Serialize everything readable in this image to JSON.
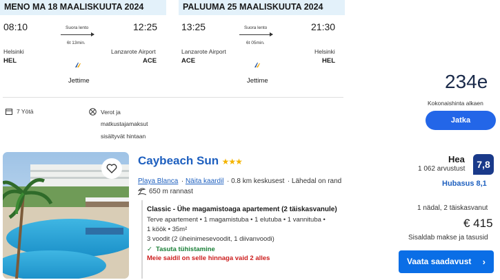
{
  "outbound": {
    "header": "MENO MA 18 MAALISKUUTA 2024",
    "depart_time": "08:10",
    "arrive_time": "12:25",
    "stop_label": "Suora lento",
    "duration": "6t 13min.",
    "depart_city": "Helsinki",
    "depart_code": "HEL",
    "arrive_city": "Lanzarote Airport",
    "arrive_code": "ACE",
    "airline": "Jettime"
  },
  "return": {
    "header": "PALUUMA 25 MAALISKUUTA 2024",
    "depart_time": "13:25",
    "arrive_time": "21:30",
    "stop_label": "Suora lento",
    "duration": "6t 05min.",
    "depart_city": "Lanzarote Airport",
    "depart_code": "ACE",
    "arrive_city": "Helsinki",
    "arrive_code": "HEL",
    "airline": "Jettime"
  },
  "package": {
    "nights": "7 Yötä",
    "taxes_line1": "Verot ja",
    "taxes_line2": "matkustajamaksut",
    "taxes_line3": "sisältyvät hintaan",
    "price": "234e",
    "price_caption": "Kokonaishinta alkaen",
    "continue_label": "Jatka"
  },
  "hotel": {
    "name": "Caybeach Sun",
    "stars": "★★★",
    "area": "Playa Blanca",
    "map_link": "Näita kaardil",
    "center_distance": "0.8 km keskusest",
    "beach_near": "Lähedal on rand",
    "beach_distance": "650 m rannast",
    "room_title": "Classic - Ühe magamistoaga apartement (2 täiskasvanule)",
    "room_line1": "Terve apartement • 1 magamistuba • 1 elutuba • 1 vannituba •",
    "room_line2": "1 köök • 35m²",
    "beds": "3 voodit (2 üheinimesevoodit, 1 diivanvoodi)",
    "free_cancel": "Tasuta tühistamine",
    "rooms_left": "Meie saidil on selle hinnaga vaid 2 alles",
    "rating_word": "Hea",
    "reviews": "1 062 arvustust",
    "score": "7,8",
    "value_rating": "Hubasus 8,1",
    "stay_info": "1 nädal, 2 täiskasvanut",
    "price": "€ 415",
    "price_note": "Sisaldab makse ja tasusid",
    "availability_button": "Vaata saadavust"
  },
  "colors": {
    "band": "#e3f1fa",
    "brand_blue": "#2366e8",
    "link_blue": "#1d5fbf",
    "score_bg": "#1a3a8a",
    "green": "#1a7f37",
    "red": "#cc1d1d"
  }
}
